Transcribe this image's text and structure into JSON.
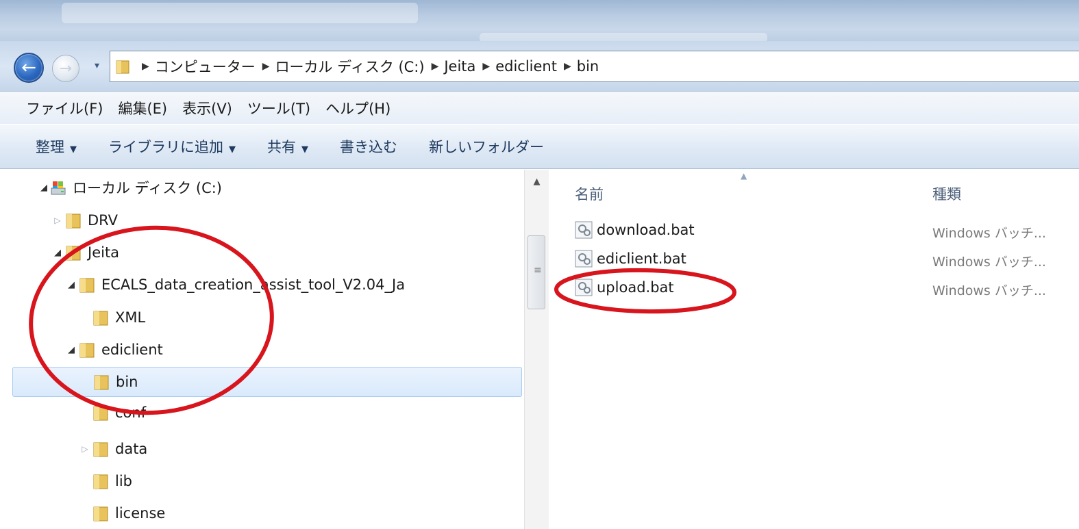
{
  "window": {
    "accent": "#2b67c0"
  },
  "address_bar": {
    "crumbs": [
      "コンピューター",
      "ローカル ディスク (C:)",
      "Jeita",
      "ediclient",
      "bin"
    ]
  },
  "menu": {
    "items": [
      "ファイル(F)",
      "編集(E)",
      "表示(V)",
      "ツール(T)",
      "ヘルプ(H)"
    ]
  },
  "commands": {
    "organize": "整理",
    "add_library": "ライブラリに追加",
    "share": "共有",
    "burn": "書き込む",
    "new_folder": "新しいフォルダー"
  },
  "tree": {
    "items": [
      {
        "label": "ローカル ディスク (C:)",
        "icon": "drive-icon",
        "expand": "expanded"
      },
      {
        "label": "DRV",
        "icon": "folder-icon",
        "expand": "collapsed"
      },
      {
        "label": "Jeita",
        "icon": "folder-icon",
        "expand": "expanded"
      },
      {
        "label": "ECALS_data_creation_assist_tool_V2.04_Ja",
        "icon": "folder-icon",
        "expand": "expanded"
      },
      {
        "label": "XML",
        "icon": "folder-icon",
        "expand": "none"
      },
      {
        "label": "ediclient",
        "icon": "folder-icon",
        "expand": "expanded"
      },
      {
        "label": "bin",
        "icon": "folder-icon",
        "expand": "none",
        "selected": true
      },
      {
        "label": "conf",
        "icon": "folder-icon",
        "expand": "none"
      },
      {
        "label": "data",
        "icon": "folder-icon",
        "expand": "collapsed"
      },
      {
        "label": "lib",
        "icon": "folder-icon",
        "expand": "none"
      },
      {
        "label": "license",
        "icon": "folder-icon",
        "expand": "none"
      }
    ]
  },
  "file_list": {
    "columns": {
      "name": "名前",
      "type": "種類"
    },
    "files": [
      {
        "name": "download.bat",
        "type": "Windows バッチ..."
      },
      {
        "name": "ediclient.bat",
        "type": "Windows バッチ..."
      },
      {
        "name": "upload.bat",
        "type": "Windows バッチ..."
      }
    ]
  },
  "annotation_color": "#d8141c"
}
